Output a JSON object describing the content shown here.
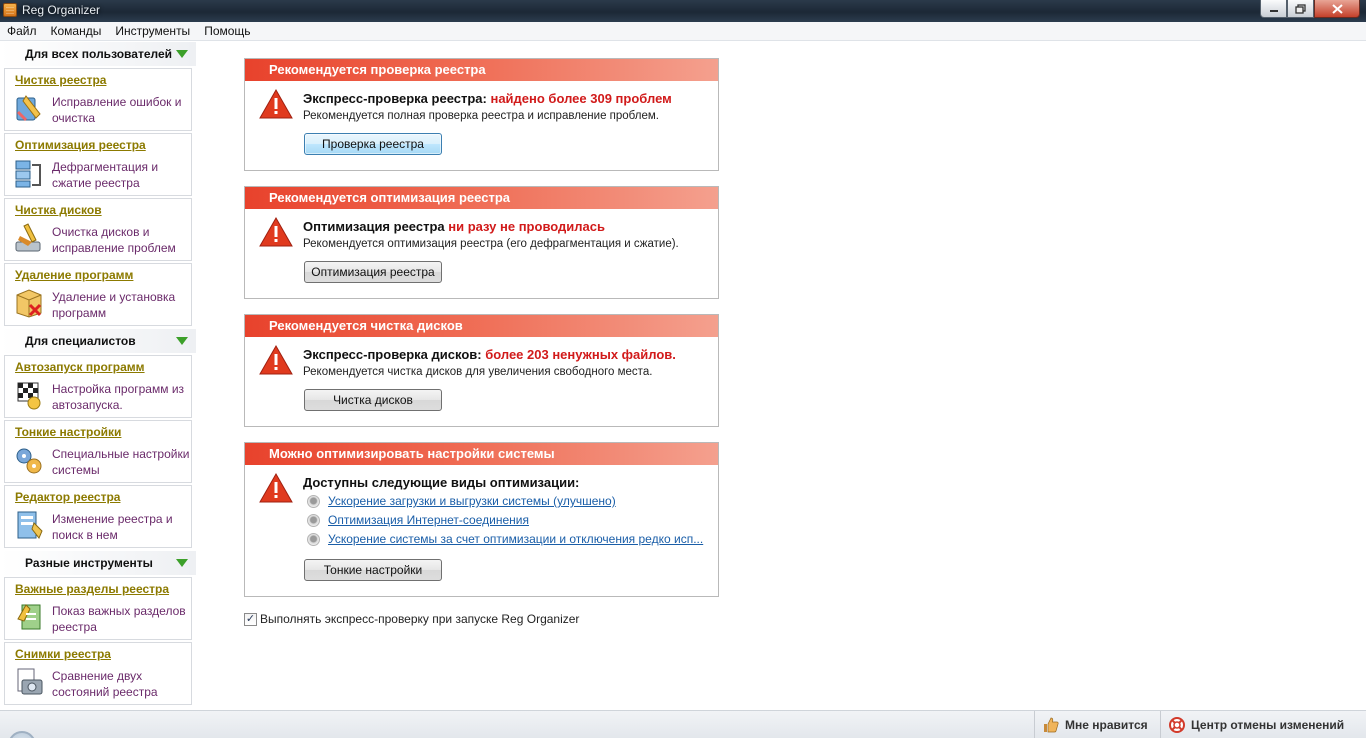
{
  "window": {
    "title": "Reg Organizer"
  },
  "menu": [
    "Файл",
    "Команды",
    "Инструменты",
    "Помощь"
  ],
  "sidebar": {
    "sections": [
      {
        "title": "Для всех пользователей",
        "items": [
          {
            "link": "Чистка реестра",
            "desc": "Исправление ошибок и очистка",
            "icon": "registry-cleanup-icon"
          },
          {
            "link": "Оптимизация реестра",
            "desc": "Дефрагментация и сжатие реестра",
            "icon": "registry-optimize-icon"
          },
          {
            "link": "Чистка дисков",
            "desc": "Очистка дисков и исправление проблем",
            "icon": "disk-cleanup-icon"
          },
          {
            "link": "Удаление программ",
            "desc": "Удаление и установка программ",
            "icon": "uninstall-icon"
          }
        ]
      },
      {
        "title": "Для специалистов",
        "items": [
          {
            "link": "Автозапуск программ",
            "desc": "Настройка программ из автозапуска.",
            "icon": "autostart-icon"
          },
          {
            "link": "Тонкие настройки",
            "desc": "Специальные настройки системы",
            "icon": "tweaks-icon"
          },
          {
            "link": "Редактор реестра",
            "desc": "Изменение реестра и поиск в нем",
            "icon": "registry-editor-icon"
          }
        ]
      },
      {
        "title": "Разные инструменты",
        "items": [
          {
            "link": "Важные разделы реестра",
            "desc": "Показ важных разделов реестра",
            "icon": "important-keys-icon"
          },
          {
            "link": "Снимки реестра",
            "desc": "Сравнение двух состояний реестра",
            "icon": "snapshot-icon"
          }
        ]
      }
    ]
  },
  "cards": [
    {
      "header": "Рекомендуется проверка реестра",
      "headline": "Экспресс-проверка реестра: ",
      "headline_red": "найдено более 309 проблем",
      "sub": "Рекомендуется полная проверка реестра и исправление проблем.",
      "button": "Проверка реестра"
    },
    {
      "header": "Рекомендуется оптимизация реестра",
      "headline": "Оптимизация реестра ",
      "headline_red": "ни разу не проводилась",
      "sub": "Рекомендуется оптимизация реестра (его дефрагментация и сжатие).",
      "button": "Оптимизация реестра"
    },
    {
      "header": "Рекомендуется чистка дисков",
      "headline": "Экспресс-проверка дисков: ",
      "headline_red": "более 203 ненужных файлов.",
      "sub": "Рекомендуется чистка дисков для увеличения свободного места.",
      "button": "Чистка дисков"
    },
    {
      "header": "Можно оптимизировать настройки системы",
      "headline": "Доступны следующие виды оптимизации:",
      "headline_red": "",
      "options": [
        "Ускорение загрузки и выгрузки системы (улучшено)",
        "Оптимизация Интернет-соединения",
        "Ускорение системы за счет оптимизации и отключения редко исп..."
      ],
      "button": "Тонкие настройки"
    }
  ],
  "express_check": {
    "label": "Выполнять экспресс-проверку при запуске Reg Organizer",
    "checked": true,
    "check_glyph": "✓"
  },
  "statusbar": {
    "like": "Мне нравится",
    "undo_center": "Центр отмены изменений"
  },
  "colors": {
    "accent_header": "#e8422c",
    "warning_red": "#d11a1a",
    "sidebar_link": "#8c7a00",
    "sidebar_desc": "#6a2a6a",
    "link_blue": "#1a5ea8"
  }
}
